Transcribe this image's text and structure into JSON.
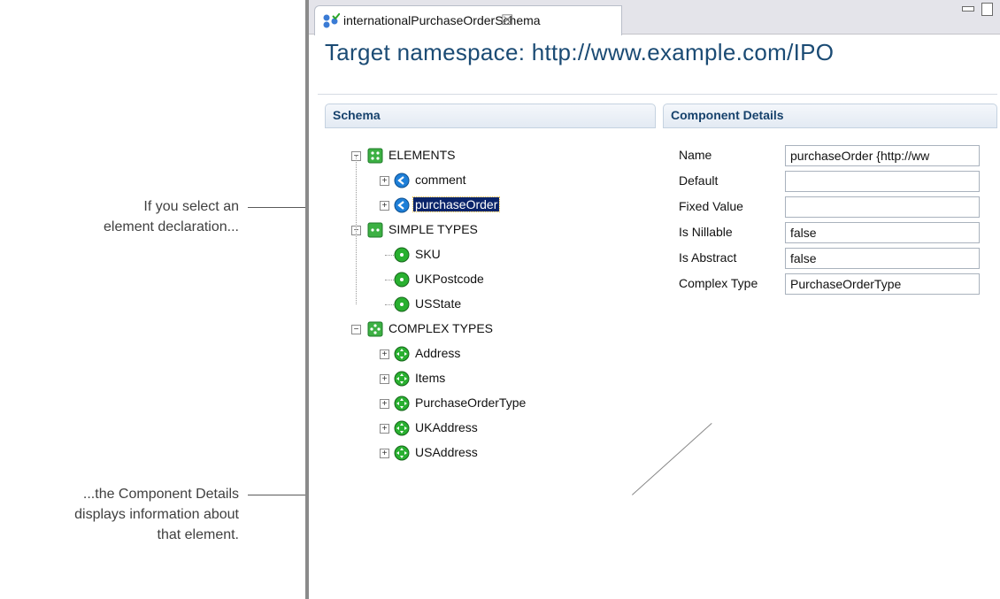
{
  "callouts": {
    "first": "If you select an\nelement declaration...",
    "second": "...the  Component Details\ndisplays information about\nthat element."
  },
  "editor": {
    "tab_title": "internationalPurchaseOrderSchema",
    "tab_close": "☒",
    "namespace_title": "Target namespace: http://www.example.com/IPO"
  },
  "schema": {
    "heading": "Schema",
    "groups": [
      {
        "label": "ELEMENTS",
        "items": [
          "comment",
          "purchaseOrder"
        ]
      },
      {
        "label": "SIMPLE TYPES",
        "items": [
          "SKU",
          "UKPostcode",
          "USState"
        ]
      },
      {
        "label": "COMPLEX TYPES",
        "items": [
          "Address",
          "Items",
          "PurchaseOrderType",
          "UKAddress",
          "USAddress"
        ]
      }
    ],
    "selected": "purchaseOrder"
  },
  "component_details": {
    "heading": "Component Details",
    "props": [
      {
        "label": "Name",
        "value": "purchaseOrder  {http://ww"
      },
      {
        "label": "Default",
        "value": ""
      },
      {
        "label": "Fixed Value",
        "value": ""
      },
      {
        "label": "Is Nillable",
        "value": "false"
      },
      {
        "label": "Is Abstract",
        "value": "false"
      },
      {
        "label": "Complex Type",
        "value": "PurchaseOrderType"
      }
    ]
  },
  "colors": {
    "title": "#1b4b74",
    "selection": "#0a246a",
    "group_icon": "#3cb043"
  }
}
